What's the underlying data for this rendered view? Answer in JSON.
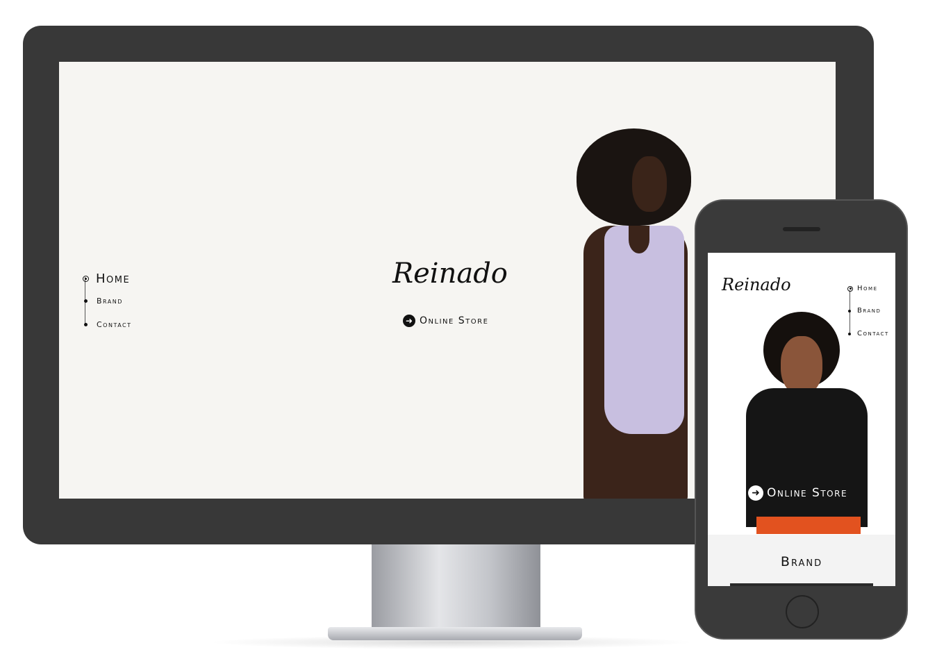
{
  "desktop": {
    "logo": "Reinado",
    "nav": [
      {
        "label": "Home",
        "active": true
      },
      {
        "label": "Brand",
        "active": false
      },
      {
        "label": "Contact",
        "active": false
      }
    ],
    "cta": "Online Store"
  },
  "mobile": {
    "logo": "Reinado",
    "nav": [
      {
        "label": "Home",
        "active": true
      },
      {
        "label": "Brand",
        "active": false
      },
      {
        "label": "Contact",
        "active": false
      }
    ],
    "cta": "Online Store",
    "section_title": "Brand"
  },
  "colors": {
    "bezel": "#383838",
    "dress": "#c8bfe0",
    "pants": "#e2521f"
  }
}
